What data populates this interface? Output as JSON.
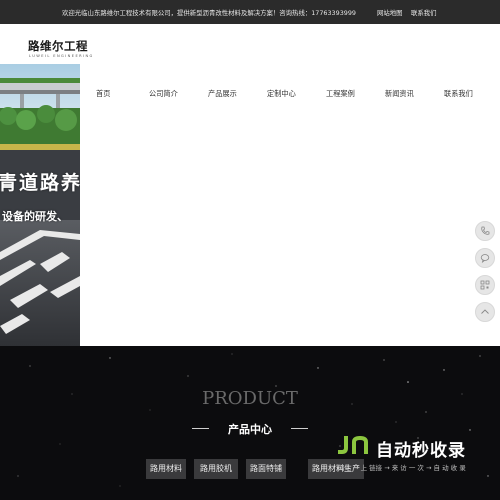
{
  "topbar": {
    "welcome": "欢迎光临山东路维尔工程技术有限公司，提供新型沥青改性材料及解决方案！咨询热线：17763393999",
    "site_map": "网站地图",
    "contact_us": "联系我们"
  },
  "header": {
    "logo_text": "路维尔工程",
    "logo_sub": "LUWEIL ENGINEERING"
  },
  "nav": {
    "items": [
      "首页",
      "公司简介",
      "产品展示",
      "定制中心",
      "工程案例",
      "新闻资讯",
      "联系我们"
    ]
  },
  "hero": {
    "title": "青道路养",
    "subtitle": "设备的研发、"
  },
  "side_tools": [
    "phone-icon",
    "chat-icon",
    "qrcode-icon",
    "back-to-top-icon"
  ],
  "products": {
    "title_en": "PRODUCT",
    "title_cn": "产品中心",
    "categories": [
      "路用材料",
      "路用胶机",
      "路面特铺",
      "路用材料生产"
    ]
  },
  "watermark": {
    "title": "自动秒收录",
    "subtitle": "网站 → 上 链接 → 来 访 一 次 → 自 动 收 录"
  },
  "colors": {
    "topbar_bg": "#2b2b2b",
    "product_bg": "#0c0c0e",
    "button_bg": "#3a3a3c",
    "watermark_accent": "#8cc63f"
  }
}
